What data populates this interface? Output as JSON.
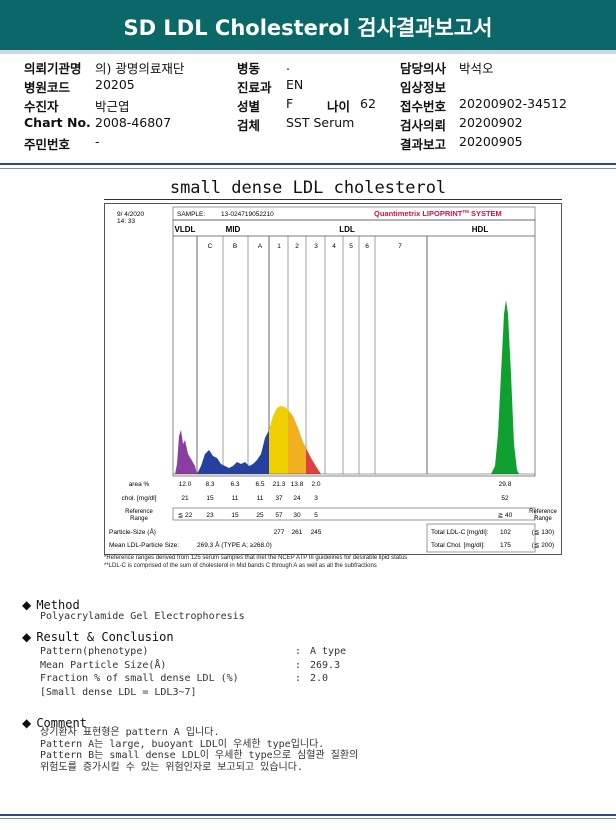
{
  "header": {
    "title": "SD LDL Cholesterol 검사결과보고서"
  },
  "patient": {
    "institution_label": "의뢰기관명",
    "institution": "의) 광명의료재단",
    "ward_label": "병동",
    "ward": ".",
    "doctor_label": "담당의사",
    "doctor": "박석오",
    "hospital_code_label": "병원코드",
    "hospital_code": "20205",
    "dept_label": "진료과",
    "dept": "EN",
    "clinical_label": "임상정보",
    "clinical": "",
    "name_label": "수진자",
    "name": "박근엽",
    "sex_label": "성별",
    "sex": "F",
    "age_label": "나이",
    "age": "62",
    "receipt_label": "접수번호",
    "receipt": "20200902-34512",
    "chart_label": "Chart No.",
    "chart": "2008-46807",
    "specimen_label": "검체",
    "specimen": "SST Serum",
    "request_label": "검사의뢰",
    "request": "20200902",
    "rrn_label": "주민번호",
    "rrn": "-",
    "report_label": "결과보고",
    "report": "20200905"
  },
  "section_title": "small dense LDL cholesterol",
  "chart_data": {
    "type": "area",
    "title": "small dense LDL cholesterol",
    "date": "9/ 4/2020",
    "time": "14: 33",
    "sample_label": "SAMPLE:",
    "sample_id": "13-024719052210",
    "brand": "Quantimetrix LIPOPRINT",
    "brand_tm": "TM",
    "brand_suffix": " SYSTEM",
    "groups": [
      "VLDL",
      "MID",
      "LDL",
      "HDL"
    ],
    "bands": [
      "C",
      "B",
      "A",
      "1",
      "2",
      "3",
      "4",
      "5",
      "6",
      "7"
    ],
    "row_labels": {
      "area": "area %",
      "chol": "chol. [mg/dl]",
      "ref": "Reference Range",
      "psize": "Particle-Size (Å)",
      "mean": "Mean LDL-Particle Size:"
    },
    "area_pct": {
      "VLDL": 12.0,
      "C": 8.3,
      "B": 6.3,
      "A": 6.5,
      "1": 21.3,
      "2": 13.8,
      "3": 2.0,
      "HDL": 29.8
    },
    "chol_mgdl": {
      "VLDL": 21,
      "C": 15,
      "B": 11,
      "A": 11,
      "1": 37,
      "2": 24,
      "3": 3,
      "HDL": 52
    },
    "reference": {
      "VLDL": "≦ 22",
      "C": "23",
      "B": "15",
      "A": "25",
      "1": "57",
      "2": "30",
      "3": "5",
      "HDL": "≧ 40"
    },
    "particle_size": {
      "1": 277,
      "2": 261,
      "3": 245
    },
    "mean_particle_size": "269.3 Å (TYPE A; ≥268.0)",
    "total_ldl_label": "Total LDL-C [mg/dl]:",
    "total_ldl": "102",
    "total_ldl_ref": "(≦ 130)",
    "total_chol_label": "Total Chol. [mg/dl]:",
    "total_chol": "175",
    "total_chol_ref": "(≦ 200)",
    "ref_range_header": "Reference Range",
    "footnote1": "*Reference ranges derived from 125 serum samples that met the NCEP ATP III guidelines for desirable lipid status",
    "footnote2": "**LDL-C is comprised of the sum of cholesterol in Mid bands C through A as well as all the subfractions",
    "colors": {
      "VLDL": "#8a3fa0",
      "MID": "#2640a0",
      "LDL1": "#f0d000",
      "LDL2": "#f0b020",
      "LDL3": "#e04040",
      "HDL": "#10a030"
    }
  },
  "method": {
    "heading": "Method",
    "text": "Polyacrylamide Gel Electrophoresis"
  },
  "result": {
    "heading": "Result & Conclusion",
    "rows": [
      {
        "label": "Pattern(phenotype)",
        "colon": ":",
        "value": "A type"
      },
      {
        "label": "Mean Particle Size(Å)",
        "colon": ":",
        "value": "269.3"
      },
      {
        "label": "Fraction % of small dense LDL (%)",
        "colon": ":",
        "value": "2.0"
      },
      {
        "label": "[Small dense LDL = LDL3~7]",
        "colon": "",
        "value": ""
      }
    ]
  },
  "comment": {
    "heading": "Comment",
    "lines": [
      "상기환자 표현형은 pattern A 입니다.",
      "Pattern A는 large, buoyant LDL이 우세한 type입니다.",
      "Pattern B는 small dense LDL이 우세한 type으로 심혈관 질환의",
      "위험도를 증가시킬 수 있는 위험인자로 보고되고 있습니다."
    ]
  }
}
